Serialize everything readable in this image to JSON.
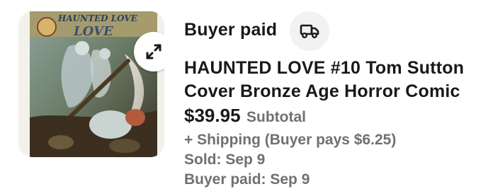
{
  "order": {
    "status_label": "Buyer paid",
    "status_icon": "truck-icon",
    "title": "HAUNTED LOVE #10 Tom Sutton Cover  Bronze Age Horror Comic",
    "price": "$39.95",
    "price_caption": "Subtotal",
    "shipping": "+ Shipping (Buyer pays $6.25)",
    "sold": "Sold: Sep 9",
    "buyer_paid": "Buyer paid: Sep 9"
  },
  "thumbnail": {
    "expand_icon": "expand-arrows-icon",
    "cover_logo_text": "HAUNTED LOVE"
  },
  "colors": {
    "primary_text": "#191919",
    "secondary_text": "#707070",
    "icon_button_bg": "#f2f2f2"
  }
}
